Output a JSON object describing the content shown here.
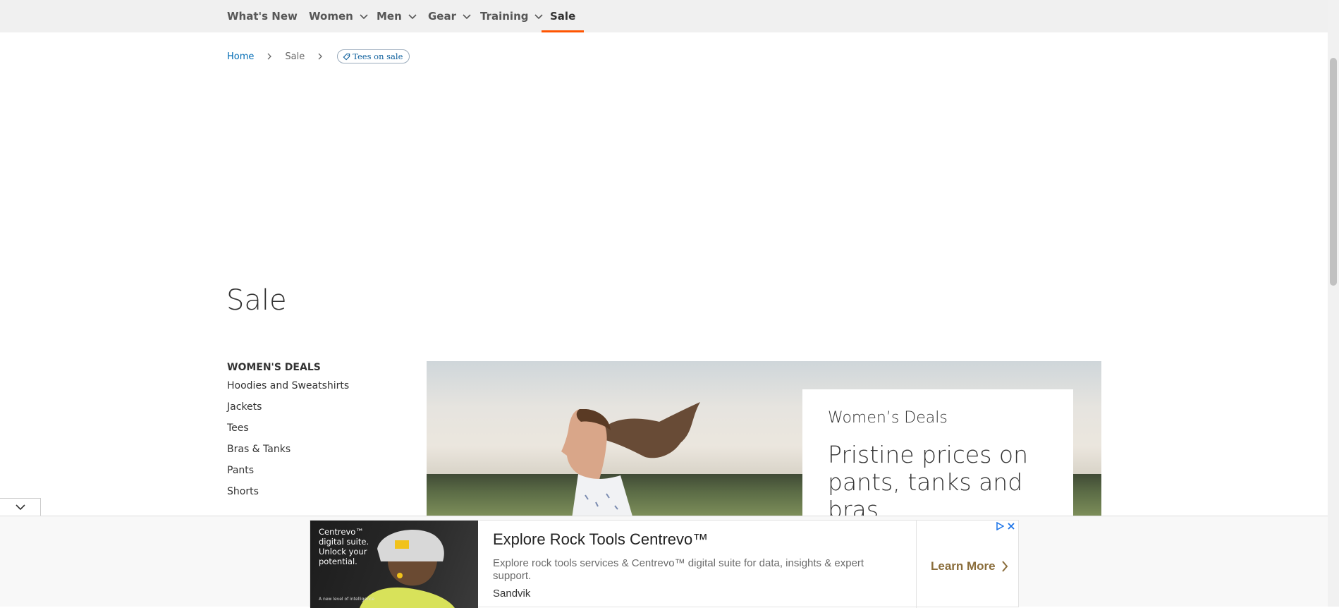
{
  "nav": {
    "items": [
      {
        "label": "What's New",
        "has_dropdown": false
      },
      {
        "label": "Women",
        "has_dropdown": true
      },
      {
        "label": "Men",
        "has_dropdown": true
      },
      {
        "label": "Gear",
        "has_dropdown": true
      },
      {
        "label": "Training",
        "has_dropdown": true
      },
      {
        "label": "Sale",
        "has_dropdown": false,
        "active": true
      }
    ],
    "active_color": "#ff5501"
  },
  "breadcrumb": {
    "home": "Home",
    "current": "Sale",
    "chip": "Tees on sale"
  },
  "page": {
    "title": "Sale"
  },
  "sidebar": {
    "heading": "WOMEN'S DEALS",
    "items": [
      "Hoodies and Sweatshirts",
      "Jackets",
      "Tees",
      "Bras & Tanks",
      "Pants",
      "Shorts"
    ]
  },
  "hero": {
    "kicker": "Women’s Deals",
    "headline": "Pristine prices on pants, tanks and bras"
  },
  "ad": {
    "image_text": "Centrevo™ digital suite. Unlock your potential.",
    "image_foot": "A new level of intelligence",
    "title": "Explore Rock Tools Centrevo™",
    "description": "Explore rock tools services & Centrevo™ digital suite for data, insights & expert support.",
    "brand": "Sandvik",
    "cta": "Learn More",
    "cta_color": "#8a6d3b"
  },
  "icons": {
    "collapse": "chevron-down-icon",
    "ad_info": "adchoices-icon",
    "ad_close": "close-icon"
  }
}
